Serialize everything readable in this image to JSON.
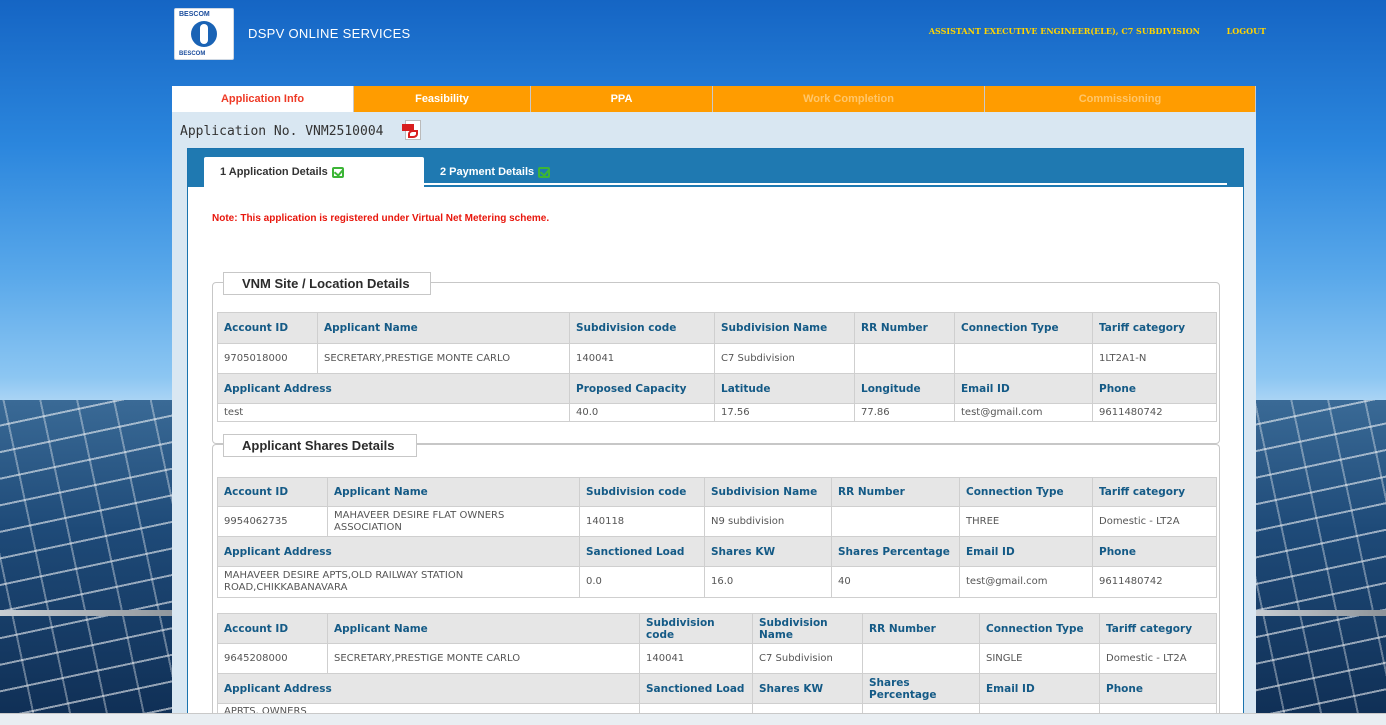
{
  "header": {
    "brand": "DSPV ONLINE SERVICES",
    "user": "ASSISTANT EXECUTIVE ENGINEER(ELE), C7 SUBDIVISION",
    "logout": "LOGOUT",
    "logo_top": "BESCOM",
    "logo_bottom": "BESCOM"
  },
  "top_tabs": [
    "Application Info",
    "Feasibility",
    "PPA",
    "Work Completion",
    "Commissioning"
  ],
  "application_no": "Application No. VNM2510004",
  "sub_tabs": [
    "1 Application Details",
    "2 Payment Details"
  ],
  "note": "Note: This application is registered under Virtual Net Metering scheme.",
  "site_section": {
    "title": "VNM Site / Location Details",
    "h1": [
      "Account ID",
      "Applicant Name",
      "Subdivision code",
      "Subdivision Name",
      "RR Number",
      "Connection Type",
      "Tariff category"
    ],
    "r1": [
      "9705018000",
      "SECRETARY,PRESTIGE MONTE CARLO",
      "140041",
      "C7 Subdivision",
      "",
      "",
      "1LT2A1-N"
    ],
    "h2": [
      "Applicant Address",
      "Proposed Capacity",
      "Latitude",
      "Longitude",
      "Email ID",
      "Phone"
    ],
    "r2": [
      "test",
      "40.0",
      "17.56",
      "77.86",
      "test@gmail.com",
      "9611480742"
    ]
  },
  "shares_section": {
    "title": "Applicant Shares Details",
    "t1": {
      "h1": [
        "Account ID",
        "Applicant Name",
        "Subdivision code",
        "Subdivision Name",
        "RR Number",
        "Connection Type",
        "Tariff category"
      ],
      "r1": [
        "9954062735",
        "MAHAVEER DESIRE FLAT OWNERS ASSOCIATION",
        "140118",
        "N9 subdivision",
        "",
        "THREE",
        "Domestic - LT2A"
      ],
      "h2": [
        "Applicant Address",
        "Sanctioned Load",
        "Shares KW",
        "Shares Percentage",
        "Email ID",
        "Phone"
      ],
      "r2": [
        "MAHAVEER DESIRE APTS,OLD RAILWAY STATION ROAD,CHIKKABANAVARA",
        "0.0",
        "16.0",
        "40",
        "test@gmail.com",
        "9611480742"
      ]
    },
    "t2": {
      "h1": [
        "Account ID",
        "Applicant Name",
        "Subdivision code",
        "Subdivision Name",
        "RR Number",
        "Connection Type",
        "Tariff category"
      ],
      "r1": [
        "9645208000",
        "SECRETARY,PRESTIGE MONTE CARLO",
        "140041",
        "C7 Subdivision",
        "",
        "SINGLE",
        "Domestic - LT2A"
      ],
      "h2": [
        "Applicant Address",
        "Sanctioned Load",
        "Shares KW",
        "Shares Percentage",
        "Email ID",
        "Phone"
      ],
      "r2_partial": "APRTS, OWNERS"
    }
  }
}
